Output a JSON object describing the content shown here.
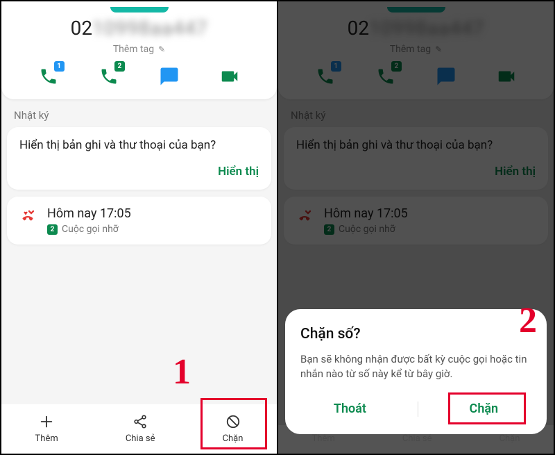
{
  "phone_prefix": "02",
  "phone_masked": "10998aa447",
  "tag_label": "Thêm tag",
  "badge_sim1": "1",
  "badge_sim2": "2",
  "section_log": "Nhật ký",
  "prompt": "Hiển thị bản ghi và thư thoại của bạn?",
  "show_label": "Hiển thị",
  "log_time": "Hôm nay 17:05",
  "log_sim": "2",
  "log_desc": "Cuộc gọi nhỡ",
  "bottom": {
    "more": "Thêm",
    "share": "Chia sẻ",
    "block": "Chặn"
  },
  "annot_1": "1",
  "annot_2": "2",
  "dialog": {
    "title": "Chặn số?",
    "body": "Bạn sẽ không nhận được bất kỳ cuộc gọi hoặc tin nhắn nào từ số này kể từ bây giờ.",
    "cancel": "Thoát",
    "confirm": "Chặn"
  }
}
